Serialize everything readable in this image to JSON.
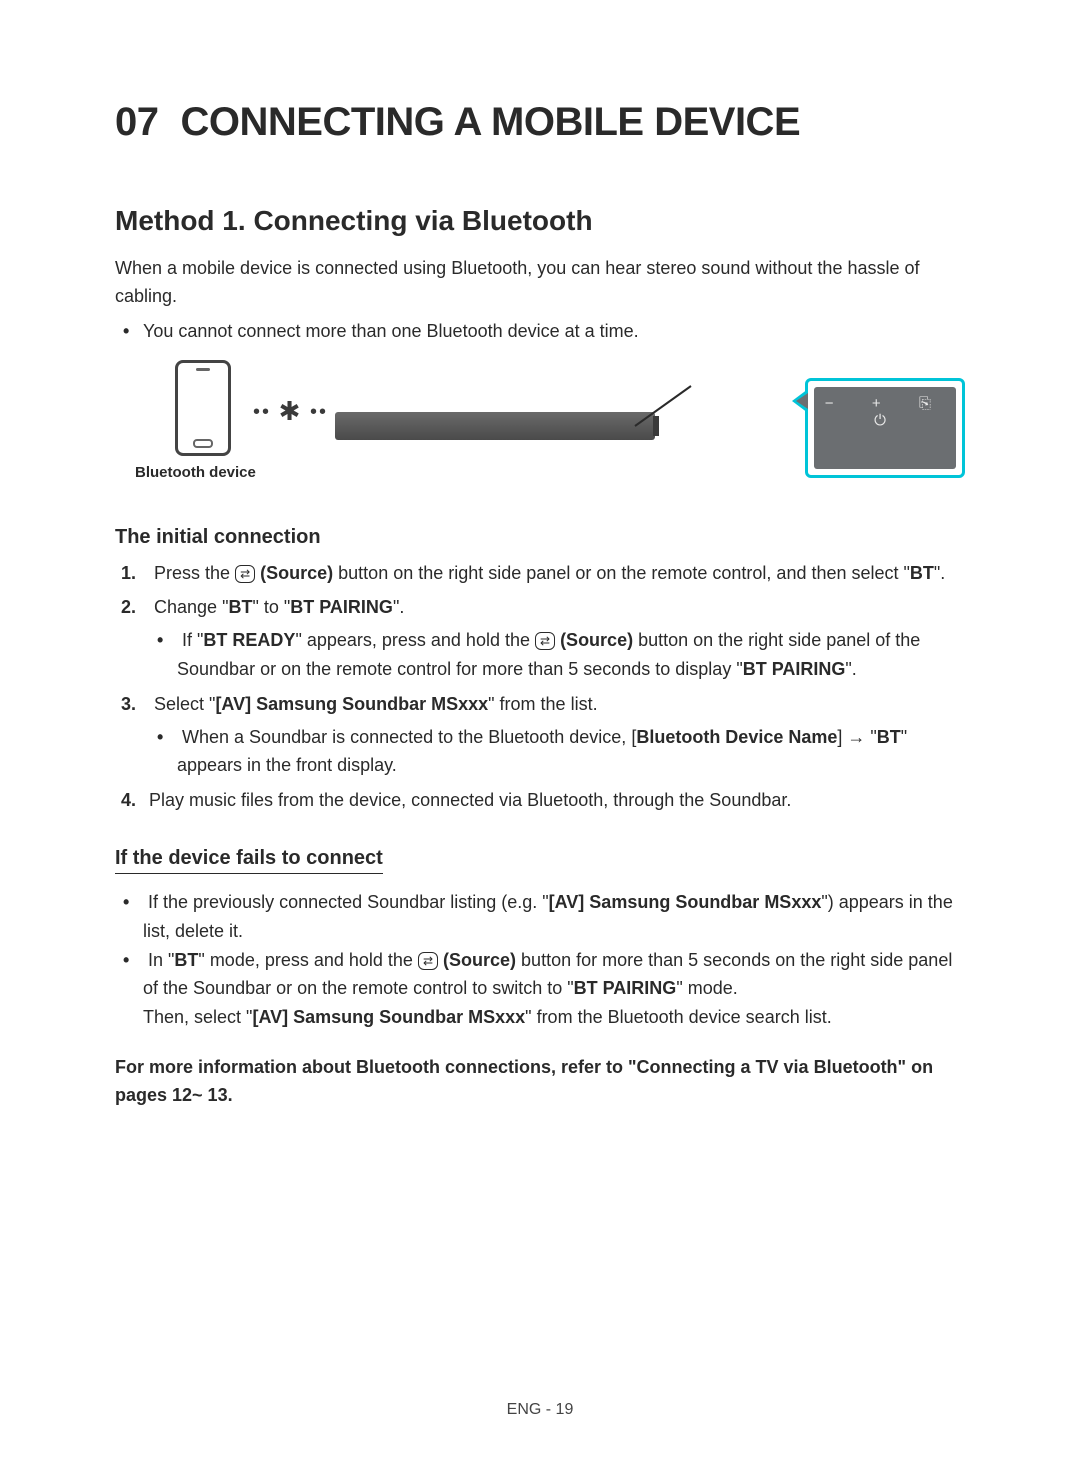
{
  "chapter": {
    "num": "07",
    "title": "CONNECTING A MOBILE DEVICE"
  },
  "method_heading": "Method 1. Connecting via Bluetooth",
  "intro": "When a mobile device is connected using Bluetooth, you can hear stereo sound without the hassle of cabling.",
  "intro_bullet": "You cannot connect more than one Bluetooth device at a time.",
  "diagram": {
    "phone_label": "Bluetooth device",
    "panel_icons": "−   +  ↲  ⏻"
  },
  "initial_heading": "The initial connection",
  "steps": {
    "s1_a": "Press the ",
    "s1_source": "(Source)",
    "s1_b": " button on the right side panel or on the remote control, and then select \"",
    "s1_bt": "BT",
    "s1_c": "\".",
    "s2_a": "Change \"",
    "s2_bt": "BT",
    "s2_b": "\" to \"",
    "s2_pair": "BT PAIRING",
    "s2_c": "\".",
    "s2_sub_a": "If \"",
    "s2_sub_ready": "BT READY",
    "s2_sub_b": "\" appears, press and hold the ",
    "s2_sub_source": "(Source)",
    "s2_sub_c": " button on the right side panel of the Soundbar or on the remote control for more than 5 seconds to display \"",
    "s2_sub_pair": "BT PAIRING",
    "s2_sub_d": "\".",
    "s3_a": "Select \"",
    "s3_dev": "[AV] Samsung Soundbar MSxxx",
    "s3_b": "\" from the list.",
    "s3_sub_a": "When a Soundbar is connected to the Bluetooth device, [",
    "s3_sub_name": "Bluetooth Device Name",
    "s3_sub_b": "] → \"",
    "s3_sub_bt": "BT",
    "s3_sub_c": "\" appears in the front display.",
    "s4": "Play music files from the device, connected via Bluetooth, through the Soundbar."
  },
  "fails_heading": "If the device fails to connect",
  "fails": {
    "b1_a": "If the previously connected Soundbar listing (e.g. \"",
    "b1_dev": "[AV] Samsung Soundbar MSxxx",
    "b1_b": "\") appears in the list, delete it.",
    "b2_a": "In \"",
    "b2_bt": "BT",
    "b2_b": "\" mode, press and hold the ",
    "b2_source": "(Source)",
    "b2_c": " button for more than 5 seconds on the right side panel of the Soundbar or on the remote control to switch to \"",
    "b2_pair": "BT PAIRING",
    "b2_d": "\" mode.",
    "b2_then_a": "Then, select \"",
    "b2_then_dev": "[AV] Samsung Soundbar MSxxx",
    "b2_then_b": "\" from the Bluetooth device search list."
  },
  "more_info": "For more information about Bluetooth connections, refer to \"Connecting a TV via Bluetooth\" on pages  12~ 13.",
  "footer": "ENG - 19"
}
